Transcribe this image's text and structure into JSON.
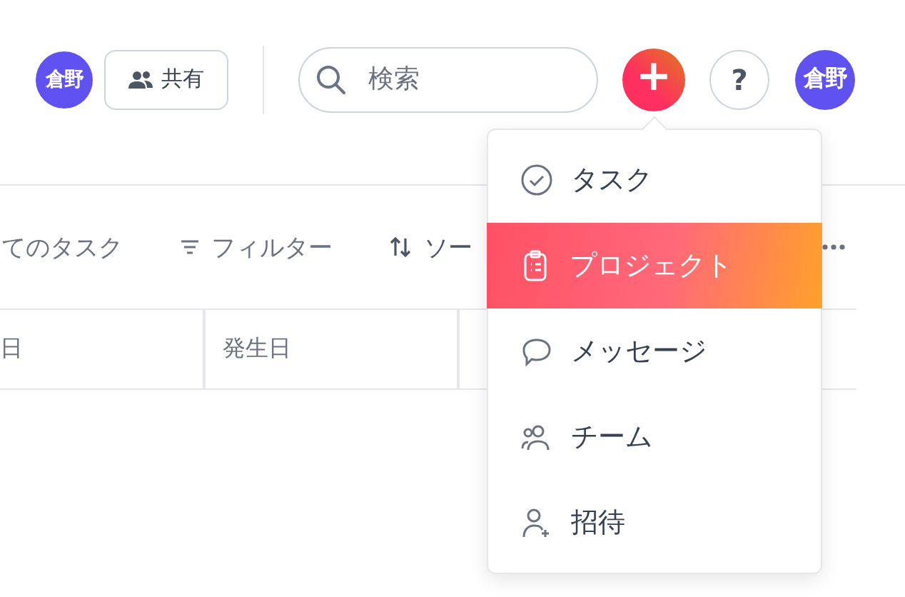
{
  "header": {
    "avatar_left": "倉野",
    "share_button": "共有",
    "search": {
      "placeholder": "検索"
    },
    "add_button": "+",
    "help_button": "?",
    "avatar_right": "倉野"
  },
  "toolbar": {
    "view": "てのタスク",
    "filter": "フィルター",
    "sort": "ソー"
  },
  "table": {
    "columns": [
      "日",
      "発生日"
    ]
  },
  "add_menu": {
    "items": [
      {
        "label": "タスク",
        "selected": false
      },
      {
        "label": "プロジェクト",
        "selected": true
      },
      {
        "label": "メッセージ",
        "selected": false
      },
      {
        "label": "チーム",
        "selected": false
      },
      {
        "label": "招待",
        "selected": false
      }
    ]
  }
}
